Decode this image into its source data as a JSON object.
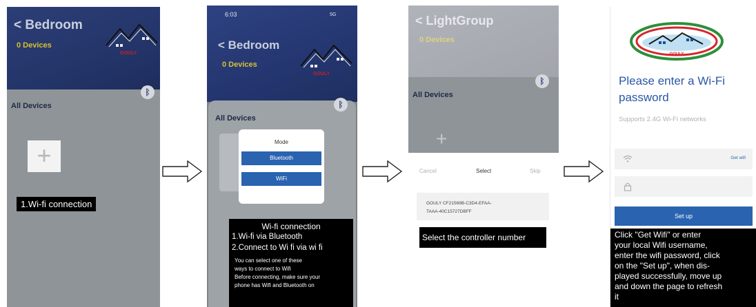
{
  "panel1": {
    "title": "< Bedroom",
    "device_count": "0 Devices",
    "brand": "GOULY",
    "section": "All Devices",
    "plus": "+",
    "step_label": "1.Wi-fi connection"
  },
  "panel2": {
    "status_time": "6:03",
    "status_right": "5G",
    "title": "< Bedroom",
    "device_count": "0 Devices",
    "brand": "GOULY",
    "section": "All Devices",
    "modal": {
      "title": "Mode",
      "options": [
        "Bluetooth",
        "WiFi"
      ]
    },
    "info": {
      "title": "Wi-fi connection",
      "lines": [
        "1.Wi-fi via Bluetooth",
        "2.Connect to Wi fi via wi fi"
      ],
      "small_lines": [
        "You can select one of these",
        "ways to connect to Wifi",
        "Before connecting, make sure your",
        "phone has Wifi and Bluetooth on"
      ]
    }
  },
  "panel3": {
    "title": "< LightGroup",
    "device_count": "0 Devices",
    "section": "All Devices",
    "plus": "+",
    "sheet": {
      "cancel": "Cancel",
      "title": "Select",
      "skip": "Skip",
      "item_lines": [
        "GOULY CF21569B-C3D4-EFAA-",
        "TAAA-40C15727DBFF"
      ]
    },
    "label": "Select the controller number"
  },
  "panel4": {
    "brand": "GOULY",
    "title_lines": [
      "Please enter a Wi-Fi",
      "password"
    ],
    "hint": "Supports 2.4G Wi-Fi networks",
    "get_wifi": "Get wifi",
    "setup": "Set up",
    "instructions": [
      "Click   \"Get Wifi\"  or enter",
      "your local Wifi username,",
      "enter the wifi password, click",
      "on the   \"Set up\", when dis-",
      "played successfully, move up",
      "and down the page to refresh",
      "it"
    ]
  },
  "colors": {
    "header_blue": "#24356a",
    "accent_blue": "#2a63b0",
    "brand_red": "#c8202a",
    "count_yellow": "#d8c030"
  },
  "icons": [
    "bluetooth-icon",
    "wifi-icon",
    "lock-icon",
    "arrow-right-icon",
    "plus-icon",
    "house-logo-icon"
  ]
}
